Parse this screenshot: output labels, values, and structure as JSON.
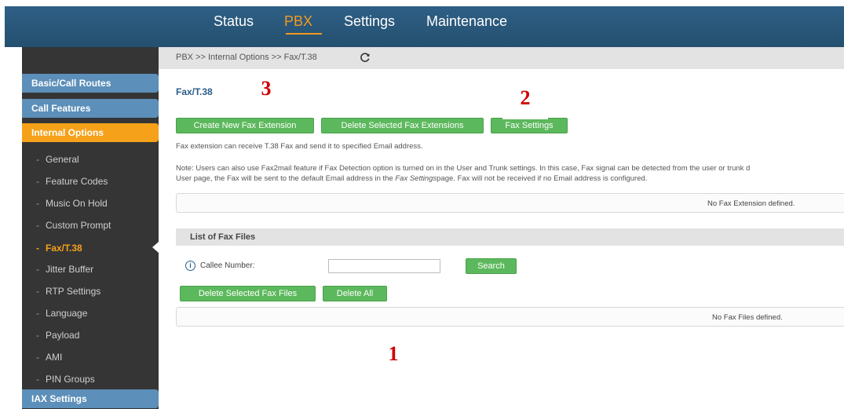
{
  "nav": {
    "items": [
      "Status",
      "PBX",
      "Settings",
      "Maintenance"
    ],
    "active": "PBX"
  },
  "sidebar": {
    "sections": [
      "Basic/Call Routes",
      "Call Features",
      "Internal Options",
      "IAX Settings"
    ],
    "items": [
      "General",
      "Feature Codes",
      "Music On Hold",
      "Custom Prompt",
      "Fax/T.38",
      "Jitter Buffer",
      "RTP Settings",
      "Language",
      "Payload",
      "AMI",
      "PIN Groups"
    ],
    "item_prefix": "-",
    "active_section": "Internal Options",
    "active_item": "Fax/T.38"
  },
  "breadcrumb": "PBX >> Internal Options >> Fax/T.38",
  "page_title": "Fax/T.38",
  "buttons": {
    "create": "Create New Fax Extension",
    "delete_extensions": "Delete Selected Fax Extensions",
    "fax_settings": "Fax Settings",
    "search": "Search",
    "delete_files": "Delete Selected Fax Files",
    "delete_all": "Delete All"
  },
  "description": "Fax extension can receive T.38 Fax and send it to specified Email address.",
  "note": {
    "line1": "Note: Users can also use Fax2mail feature if Fax Detection option is turned on in the User and Trunk settings. In this case, Fax signal can be detected from the user or trunk d",
    "line2_before": "User page, the Fax will be sent to the default Email address in the ",
    "line2_emph": "Fax Settings",
    "line2_after": "page. Fax will not be received if no Email address is configured."
  },
  "empty_extensions": "No Fax Extension defined.",
  "fax_files": {
    "title": "List of Fax Files",
    "callee_label": "Callee Number:",
    "callee_value": "",
    "empty": "No Fax Files defined."
  },
  "annotations": [
    "3",
    "2",
    "1"
  ],
  "colors": {
    "nav_bg": "#2a5779",
    "nav_active": "#f39a1d",
    "button_green": "#5cb85c",
    "sidebar_section": "#5c8fb9",
    "sidebar_active": "#f5a11a",
    "annotation": "#d00000"
  },
  "icons": {
    "refresh": "refresh-icon",
    "info": "info-icon",
    "sidebar_pointer": "pointer-arrow-icon"
  }
}
